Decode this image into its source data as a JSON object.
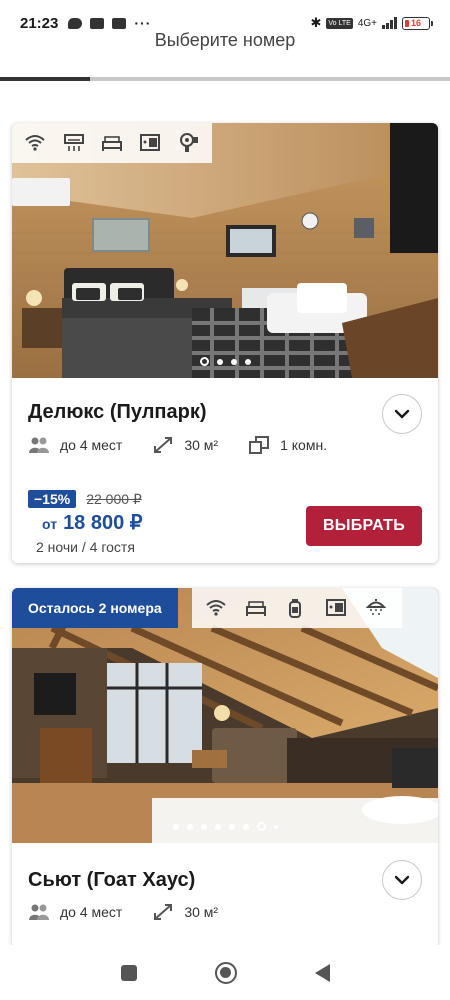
{
  "status_bar": {
    "time": "21:23",
    "more": "···",
    "volte": "Vo LTE",
    "network": "4G+",
    "battery": "16"
  },
  "header": {
    "title": "Выберите номер",
    "progress": 0.2
  },
  "rooms": [
    {
      "name": "Делюкс (Пулпарк)",
      "amenities": [
        "wifi-icon",
        "air-conditioner-icon",
        "bed-icon",
        "safe-icon",
        "hair-dryer-icon"
      ],
      "gallery": {
        "count": 4,
        "active": 1
      },
      "facts": {
        "guests": "до 4 мест",
        "area": "30 м²",
        "rooms": "1 комн."
      },
      "discount": "−15%",
      "old_price": "22 000 ₽",
      "price_prefix": "от",
      "price": "18 800 ₽",
      "stay": "2 ночи / 4 гостя",
      "select_label": "ВЫБРАТЬ"
    },
    {
      "name": "Сьют (Гоат Хаус)",
      "badge": "Осталось 2 номера",
      "amenities": [
        "wifi-icon",
        "bed-icon",
        "toiletries-icon",
        "safe-icon",
        "shower-icon"
      ],
      "gallery": {
        "count": 8,
        "active": 7
      },
      "facts": {
        "guests": "до 4 мест",
        "area": "30 м²"
      }
    }
  ],
  "colors": {
    "accent_blue": "#1e4d9b",
    "select_red": "#b3203a"
  }
}
